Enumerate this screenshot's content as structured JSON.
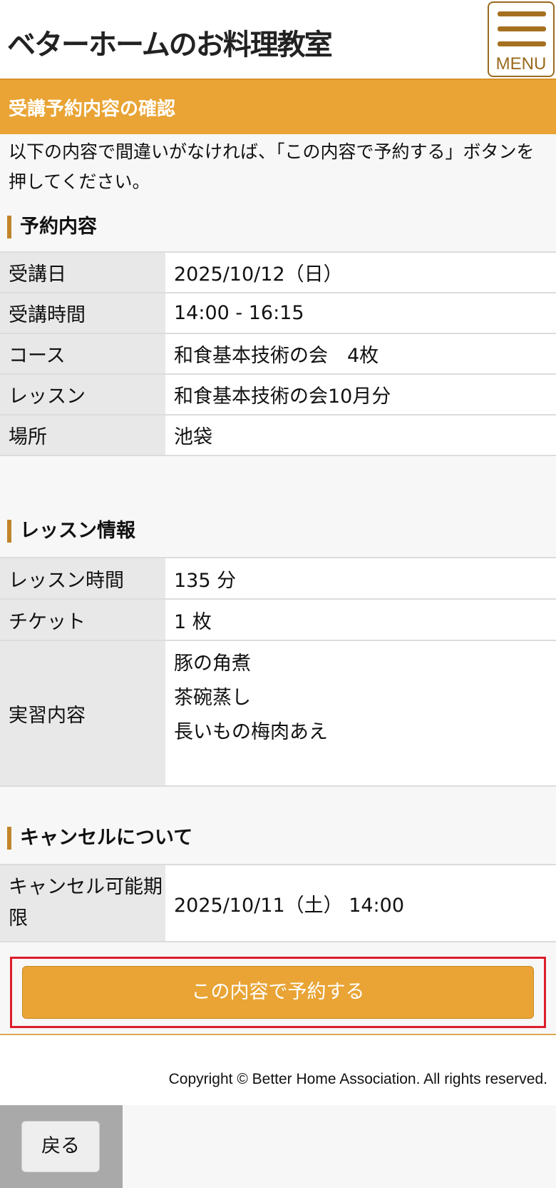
{
  "header": {
    "logo_text": "ベターホームのお料理教室",
    "menu_label": "MENU"
  },
  "title_bar": {
    "title": "受講予約内容の確認"
  },
  "intro": "以下の内容で間違いがなければ、「この内容で予約する」ボタンを押してください。",
  "reservation": {
    "heading": "予約内容",
    "rows": [
      {
        "label": "受講日",
        "value": "2025/10/12（日）"
      },
      {
        "label": "受講時間",
        "value": "14:00 - 16:15"
      },
      {
        "label": "コース",
        "value": "和食基本技術の会　4枚"
      },
      {
        "label": "レッスン",
        "value": "和食基本技術の会10月分"
      },
      {
        "label": "場所",
        "value": "池袋"
      }
    ]
  },
  "lesson": {
    "heading": "レッスン情報",
    "duration_label": "レッスン時間",
    "duration_value": "135 分",
    "ticket_label": "チケット",
    "ticket_value": "1 枚",
    "practice_label": "実習内容",
    "practice_items": [
      "豚の角煮",
      "茶碗蒸し",
      "長いもの梅肉あえ"
    ]
  },
  "cancel": {
    "heading": "キャンセルについて",
    "label": "キャンセル可能期限",
    "value": "2025/10/11（土） 14:00"
  },
  "actions": {
    "reserve_label": "この内容で予約する",
    "back_label": "戻る"
  },
  "footer": {
    "copyright": "Copyright © Better Home Association. All rights reserved."
  },
  "colors": {
    "accent": "#e9a435",
    "accent_dark": "#a5701f",
    "highlight_border": "#dd1d2a"
  }
}
